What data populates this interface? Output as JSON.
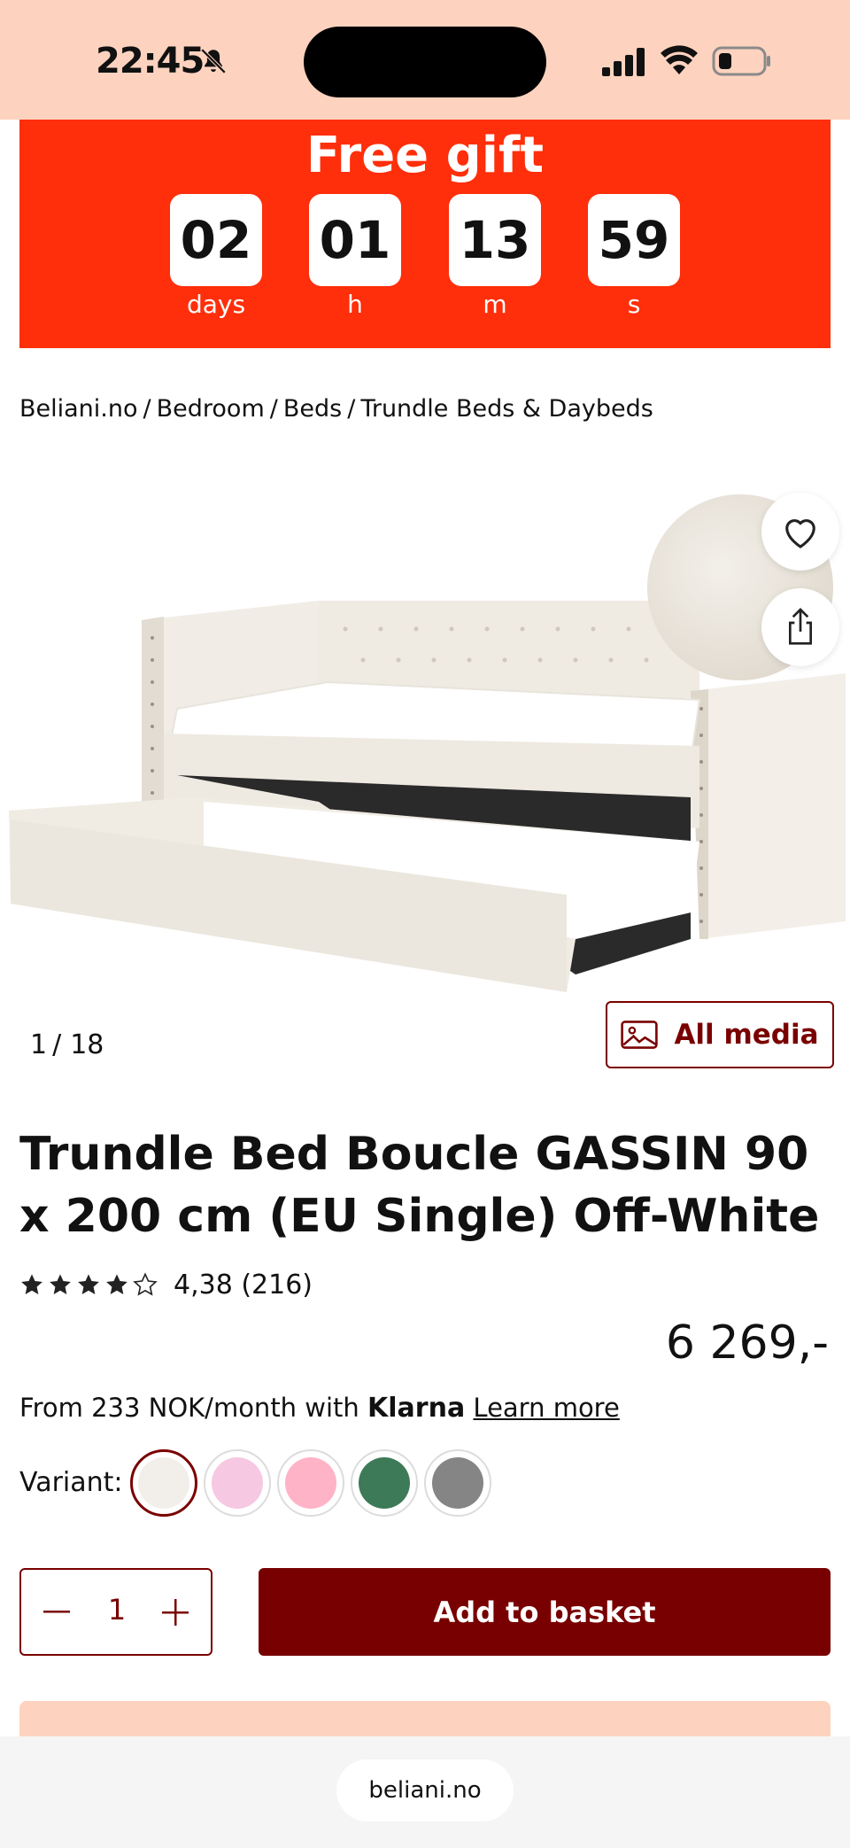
{
  "status_bar": {
    "time": "22:45",
    "icons": [
      "bell-slash-icon",
      "signal-icon",
      "wifi-icon",
      "battery-icon"
    ]
  },
  "promo": {
    "title": "Free gift",
    "countdown": [
      {
        "value": "02",
        "label": "days"
      },
      {
        "value": "01",
        "label": "h"
      },
      {
        "value": "13",
        "label": "m"
      },
      {
        "value": "59",
        "label": "s"
      }
    ],
    "background_color": "#ff2e0b"
  },
  "breadcrumb": [
    "Beliani.no",
    "Bedroom",
    "Beds",
    "Trundle Beds & Daybeds"
  ],
  "gallery": {
    "current": "1",
    "separator": "/",
    "total": "18",
    "all_media_label": "All media",
    "icons": [
      "heart-icon",
      "share-icon",
      "image-icon"
    ]
  },
  "product": {
    "title": "Trundle Bed Boucle GASSIN 90 x 200 cm (EU Single) Off-White",
    "rating_stars": 4.38,
    "rating_text": "4,38 (216)",
    "price": "6 269,-",
    "financing": {
      "prefix": "From 233 NOK/month with",
      "provider": "Klarna",
      "link": "Learn more"
    }
  },
  "variants": {
    "label": "Variant:",
    "options": [
      {
        "color": "#f2efea",
        "selected": true
      },
      {
        "color": "#f6c8e2",
        "selected": false
      },
      {
        "color": "#ffb3c6",
        "selected": false
      },
      {
        "color": "#3d7a57",
        "selected": false
      },
      {
        "color": "#858585",
        "selected": false
      }
    ]
  },
  "purchase": {
    "quantity": "1",
    "add_to_basket_label": "Add to basket"
  },
  "browser": {
    "url": "beliani.no"
  },
  "colors": {
    "brand": "#780000",
    "accent_peach": "#fdd3bf"
  }
}
